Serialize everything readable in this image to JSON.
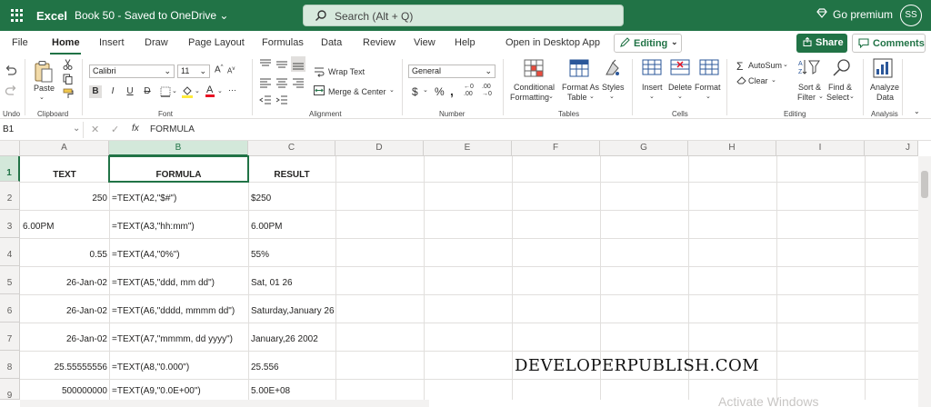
{
  "titlebar": {
    "app_name": "Excel",
    "doc_name": "Book 50 - Saved to OneDrive ⌄",
    "search_placeholder": "Search (Alt + Q)",
    "premium_label": "Go premium",
    "avatar_initials": "SS"
  },
  "tabs": [
    {
      "label": "File"
    },
    {
      "label": "Home"
    },
    {
      "label": "Insert"
    },
    {
      "label": "Draw"
    },
    {
      "label": "Page Layout"
    },
    {
      "label": "Formulas"
    },
    {
      "label": "Data"
    },
    {
      "label": "Review"
    },
    {
      "label": "View"
    },
    {
      "label": "Help"
    },
    {
      "label": "Open in Desktop App"
    }
  ],
  "editing_label": "Editing",
  "share_label": "Share",
  "comments_label": "Comments",
  "ribbon": {
    "undo_label": "Undo",
    "paste_label": "Paste",
    "clipboard_label": "Clipboard",
    "font_name": "Calibri",
    "font_size": "11",
    "font_label": "Font",
    "wrap_text": "Wrap Text",
    "merge_center": "Merge & Center",
    "alignment_label": "Alignment",
    "number_format": "General",
    "number_label": "Number",
    "conditional": "Conditional",
    "formatting": "Formatting",
    "format_as": "Format As",
    "table": "Table",
    "styles": "Styles",
    "tables_label": "Tables",
    "insert": "Insert",
    "delete": "Delete",
    "format": "Format",
    "cells_label": "Cells",
    "autosum": "AutoSum",
    "clear": "Clear",
    "sort": "Sort &",
    "filter": "Filter",
    "find": "Find &",
    "select": "Select",
    "editing_label": "Editing",
    "analyze": "Analyze",
    "data": "Data",
    "analysis_label": "Analysis"
  },
  "formula_bar": {
    "name_box": "B1",
    "content": "FORMULA"
  },
  "columns": [
    "A",
    "B",
    "C",
    "D",
    "E",
    "F",
    "G",
    "H",
    "I",
    "J"
  ],
  "rows": [
    "1",
    "2",
    "3",
    "4",
    "5",
    "6",
    "7",
    "8",
    "9"
  ],
  "cells": {
    "r1": {
      "a": "TEXT",
      "b": "FORMULA",
      "c": "RESULT"
    },
    "r2": {
      "a": "250",
      "b": "=TEXT(A2,\"$#\")",
      "c": " $250"
    },
    "r3": {
      "a": "6.00PM",
      "b": "=TEXT(A3,\"hh:mm\")",
      "c": "6.00PM"
    },
    "r4": {
      "a": "0.55",
      "b": "=TEXT(A4,\"0%\")",
      "c": "55%"
    },
    "r5": {
      "a": "26-Jan-02",
      "b": "=TEXT(A5,\"ddd, mm dd\")",
      "c": "Sat, 01 26"
    },
    "r6": {
      "a": "26-Jan-02",
      "b": "=TEXT(A6,\"dddd, mmmm dd\")",
      "c": "Saturday,January 26"
    },
    "r7": {
      "a": "26-Jan-02",
      "b": "=TEXT(A7,\"mmmm, dd yyyy\")",
      "c": "January,26 2002"
    },
    "r8": {
      "a": "25.55555556",
      "b": "=TEXT(A8,\"0.000\")",
      "c": "25.556"
    },
    "r9": {
      "a": "500000000",
      "b": "=TEXT(A9,\"0.0E+00\")",
      "c": "5.00E+08"
    }
  },
  "watermark": "DEVELOPERPUBLISH.COM",
  "activate_text": "Activate Windows"
}
